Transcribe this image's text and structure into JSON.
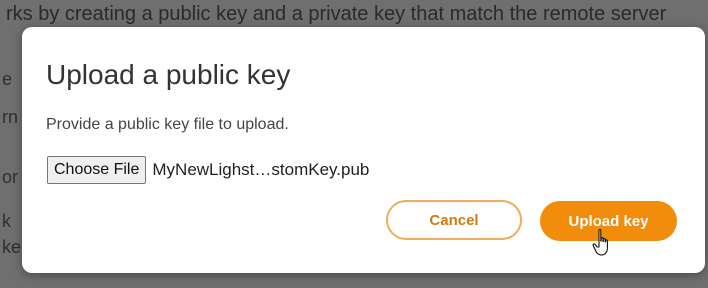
{
  "backdrop": {
    "line1": "rks by creating a public key and a private key that match the remote server",
    "fragments": [
      "e",
      "rn",
      "or",
      "k",
      "ke"
    ]
  },
  "dialog": {
    "title": "Upload a public key",
    "subtitle": "Provide a public key file to upload.",
    "file_input": {
      "button_label": "Choose File",
      "file_name": "MyNewLighst…stomKey.pub"
    },
    "cancel_label": "Cancel",
    "upload_label": "Upload key"
  },
  "colors": {
    "accent": "#f28c0b",
    "cancel_border": "#f0ac5a",
    "cancel_text": "#d07a15",
    "overlay": "#6f6f6f"
  },
  "icons": {
    "cursor": "hand-pointer-icon"
  }
}
